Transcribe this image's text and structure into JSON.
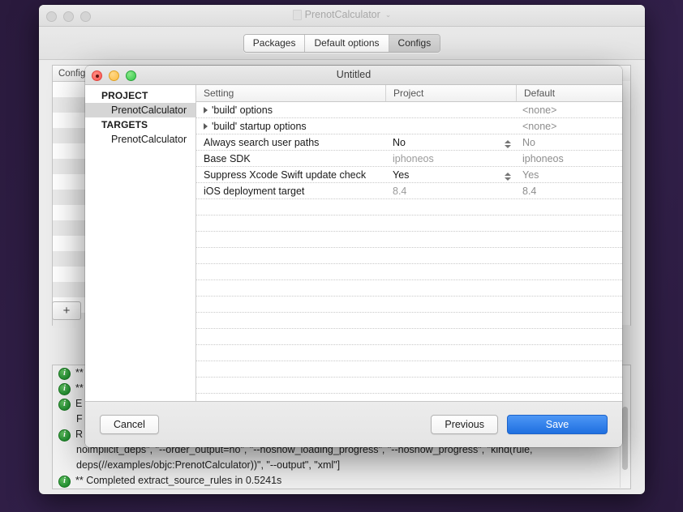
{
  "desktop": {
    "background_color": "#2c1b40"
  },
  "app_window": {
    "title": "PrenotCalculator",
    "title_icon": "document-icon",
    "title_chevron": "⌄",
    "traffic_lights": [
      "close-button",
      "minimize-button",
      "zoom-button"
    ],
    "tabs": [
      {
        "label": "Packages",
        "selected": false
      },
      {
        "label": "Default options",
        "selected": false
      },
      {
        "label": "Configs",
        "selected": true
      }
    ],
    "config_panel": {
      "column_header": "Configs",
      "row_count": 16
    },
    "add_button_label": "+",
    "log": {
      "lines": [
        {
          "icon": "info-icon",
          "text": "**",
          "continuation": false
        },
        {
          "icon": "info-icon",
          "text": "**",
          "continuation": false
        },
        {
          "icon": "info-icon",
          "text": "E",
          "continuation": false
        },
        {
          "icon": null,
          "text": "F",
          "continuation": true
        },
        {
          "icon": "info-icon",
          "text": "R",
          "continuation": false
        },
        {
          "icon": null,
          "text": "noimplicit_deps\", \"--order_output=no\", \"--noshow_loading_progress\", \"--noshow_progress\", \"kind(rule,",
          "continuation": true
        },
        {
          "icon": null,
          "text": "deps(//examples/objc:PrenotCalculator))\", \"--output\", \"xml\"]",
          "continuation": true
        },
        {
          "icon": "info-icon",
          "text": "** Completed extract_source_rules in 0.5241s",
          "continuation": false
        }
      ]
    }
  },
  "modal": {
    "title": "Untitled",
    "traffic_lights": [
      "close-button",
      "minimize-button",
      "zoom-button"
    ],
    "sidebar": [
      {
        "label": "PROJECT",
        "type": "group",
        "selected": false
      },
      {
        "label": "PrenotCalculator",
        "type": "item",
        "selected": true
      },
      {
        "label": "TARGETS",
        "type": "group",
        "selected": false
      },
      {
        "label": "PrenotCalculator",
        "type": "item",
        "selected": false
      }
    ],
    "table": {
      "columns": [
        "Setting",
        "Project",
        "Default"
      ],
      "rows": [
        {
          "setting": "'build' options",
          "disclosure": true,
          "project": "",
          "project_style": "dark",
          "stepper": false,
          "default": "<none>"
        },
        {
          "setting": "'build' startup options",
          "disclosure": true,
          "project": "",
          "project_style": "dark",
          "stepper": false,
          "default": "<none>"
        },
        {
          "setting": "Always search user paths",
          "disclosure": false,
          "project": "No",
          "project_style": "dark",
          "stepper": true,
          "default": "No"
        },
        {
          "setting": "Base SDK",
          "disclosure": false,
          "project": "iphoneos",
          "project_style": "gray",
          "stepper": false,
          "default": "iphoneos"
        },
        {
          "setting": "Suppress Xcode Swift update check",
          "disclosure": false,
          "project": "Yes",
          "project_style": "dark",
          "stepper": true,
          "default": "Yes"
        },
        {
          "setting": "iOS deployment target",
          "disclosure": false,
          "project": "8.4",
          "project_style": "gray",
          "stepper": false,
          "default": "8.4"
        }
      ],
      "empty_row_count": 14
    },
    "buttons": {
      "cancel": "Cancel",
      "previous": "Previous",
      "save": "Save",
      "save_color": "#2c7df0"
    }
  }
}
